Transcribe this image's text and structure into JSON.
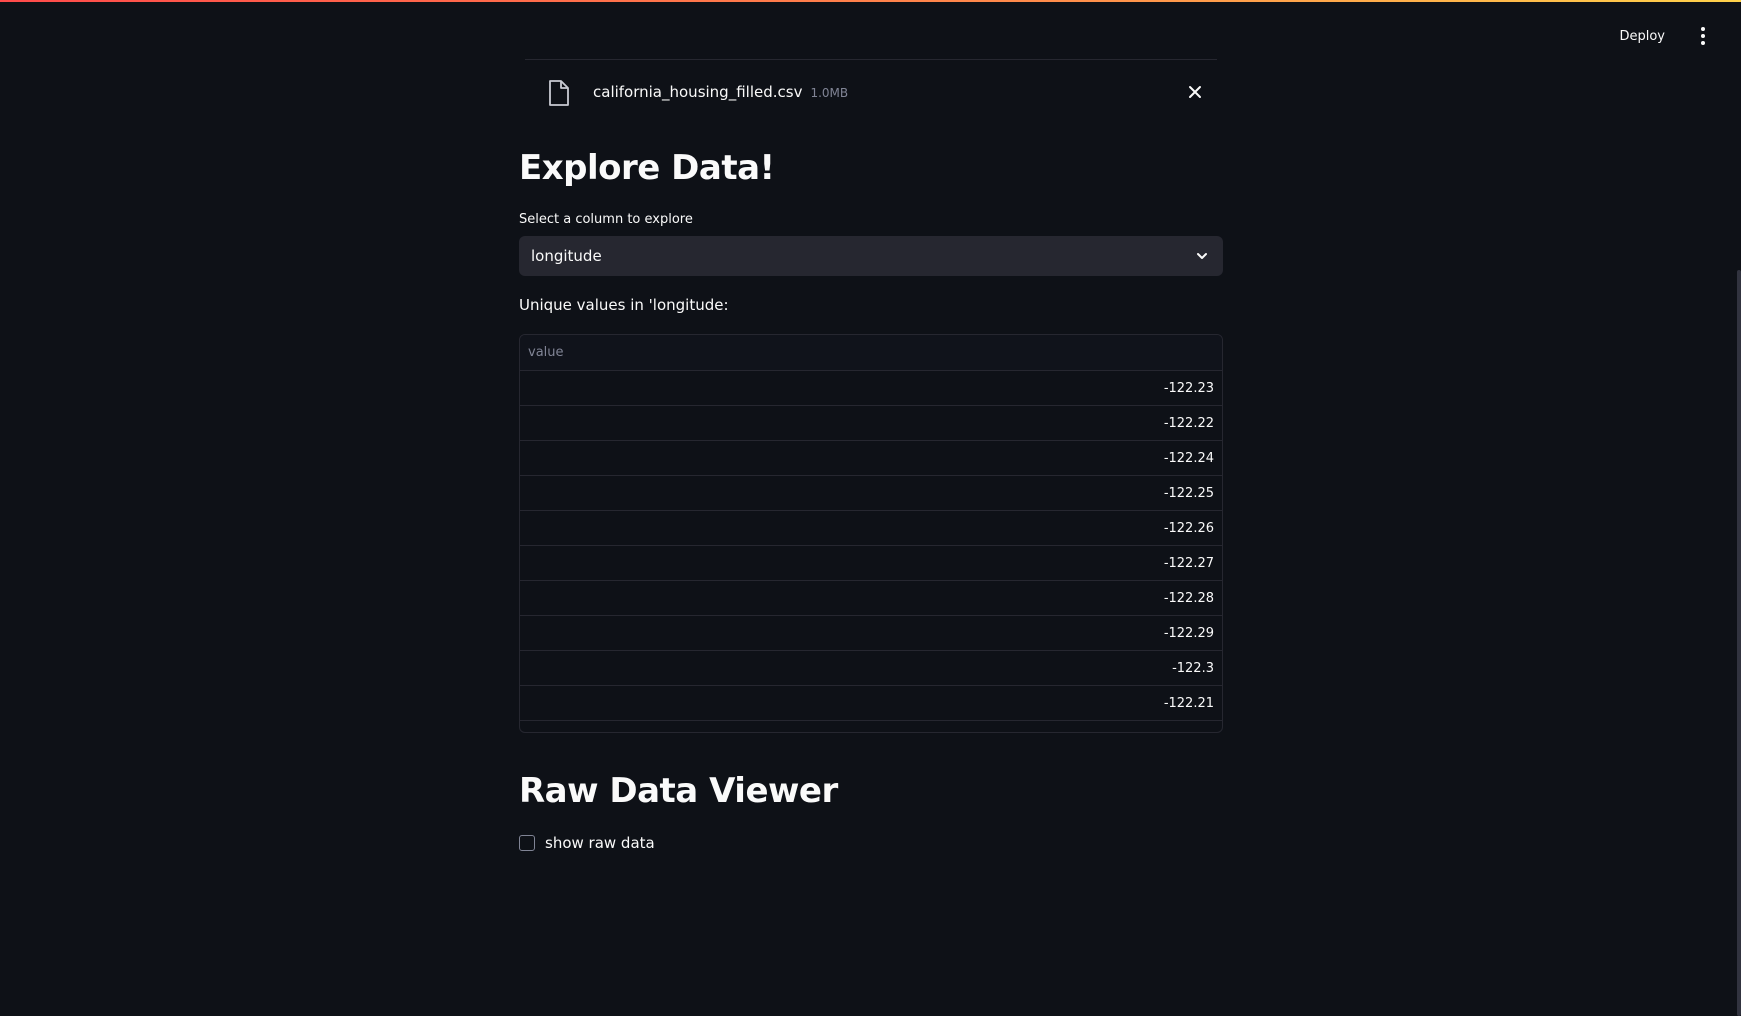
{
  "header": {
    "deploy_label": "Deploy",
    "menu_icon": "kebab-menu-icon"
  },
  "upload": {
    "file_name": "california_housing_filled.csv",
    "file_size": "1.0MB",
    "file_icon": "file-icon",
    "close_icon": "close-icon"
  },
  "explore": {
    "title": "Explore Data!",
    "select_label": "Select a column to explore",
    "select_value": "longitude",
    "unique_text": "Unique values in 'longitude:",
    "table": {
      "column_header": "value",
      "rows": [
        "-122.23",
        "-122.22",
        "-122.24",
        "-122.25",
        "-122.26",
        "-122.27",
        "-122.28",
        "-122.29",
        "-122.3",
        "-122.21"
      ]
    }
  },
  "raw": {
    "title": "Raw Data Viewer",
    "checkbox_label": "show raw data",
    "checked": false
  },
  "colors": {
    "background": "#0e1117",
    "surface": "#262730",
    "text": "#fafafa",
    "muted": "#808495",
    "accent_gradient_start": "#ff4b4b",
    "accent_gradient_end": "#ffd24b"
  }
}
